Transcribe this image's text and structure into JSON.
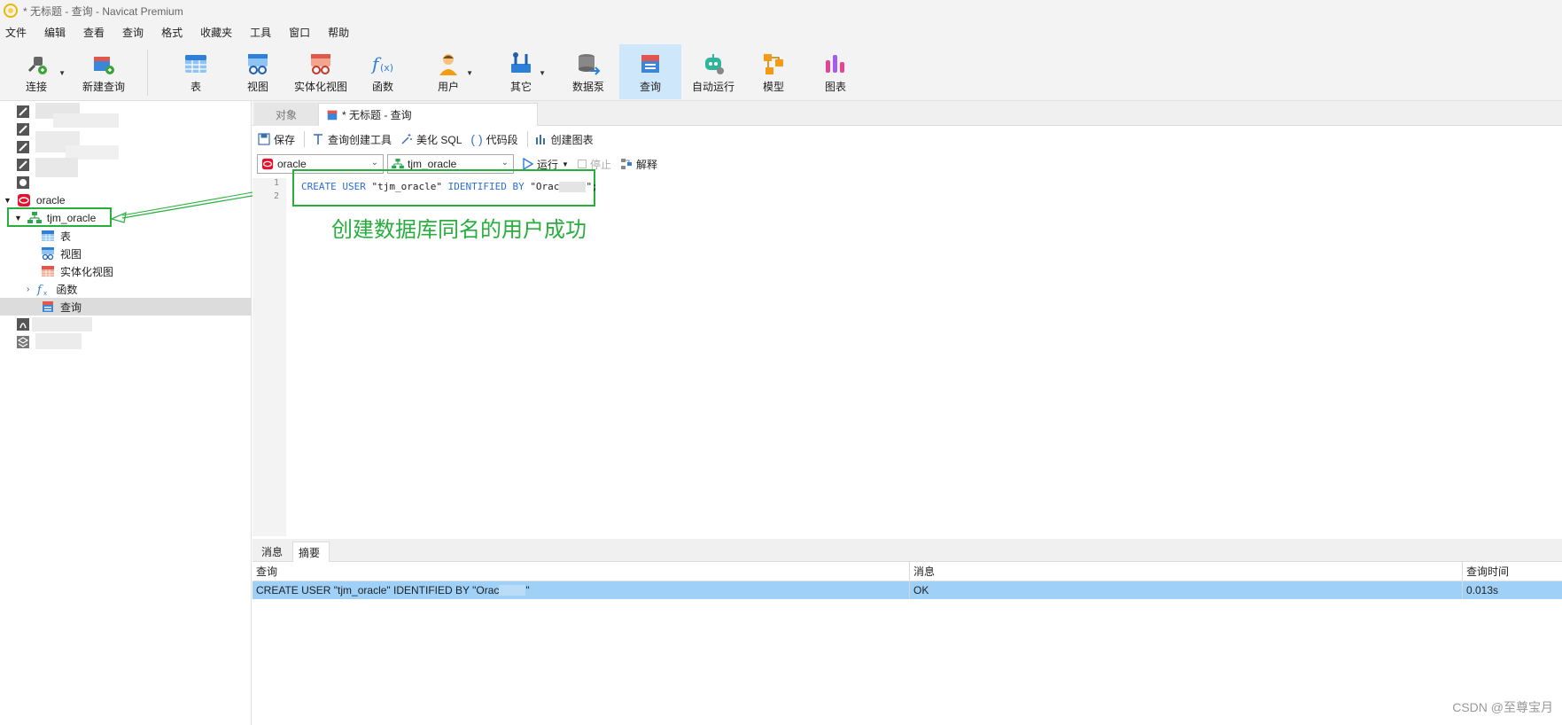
{
  "window": {
    "title": "* 无标题 - 查询 - Navicat Premium"
  },
  "menu": {
    "items": [
      "文件",
      "编辑",
      "查看",
      "查询",
      "格式",
      "收藏夹",
      "工具",
      "窗口",
      "帮助"
    ]
  },
  "toolbar": {
    "connect": "连接",
    "new_query": "新建查询",
    "table": "表",
    "view": "视图",
    "mat_view": "实体化视图",
    "function": "函数",
    "user": "用户",
    "other": "其它",
    "datapump": "数据泵",
    "query": "查询",
    "automation": "自动运行",
    "model": "模型",
    "chart": "图表"
  },
  "sidebar": {
    "connection": "oracle",
    "schema": "tjm_oracle",
    "items": [
      "表",
      "视图",
      "实体化视图",
      "函数",
      "查询"
    ]
  },
  "tabs": {
    "objects": "对象",
    "query_tab": "* 无标题 - 查询"
  },
  "query_toolbar": {
    "save": "保存",
    "query_builder": "查询创建工具",
    "beautify": "美化 SQL",
    "snippet": "代码段",
    "create_chart": "创建图表"
  },
  "selectors": {
    "connection": "oracle",
    "schema": "tjm_oracle",
    "run": "运行",
    "stop": "停止",
    "explain": "解释"
  },
  "editor": {
    "line1": "1",
    "line2": "2",
    "kw_create_user": "CREATE USER",
    "username": "\"tjm_oracle\"",
    "kw_identified_by": "IDENTIFIED BY",
    "password_visible": "\"Orac",
    "password_end": "\";"
  },
  "annotation": {
    "text": "创建数据库同名的用户成功"
  },
  "result": {
    "tab_message": "消息",
    "tab_summary": "摘要",
    "col_query": "查询",
    "col_message": "消息",
    "col_time": "查询时间",
    "row_query": "CREATE USER \"tjm_oracle\" IDENTIFIED BY \"Orac",
    "row_query_end": "\"",
    "row_message": "OK",
    "row_time": "0.013s"
  },
  "watermark": "CSDN @至尊宝月"
}
